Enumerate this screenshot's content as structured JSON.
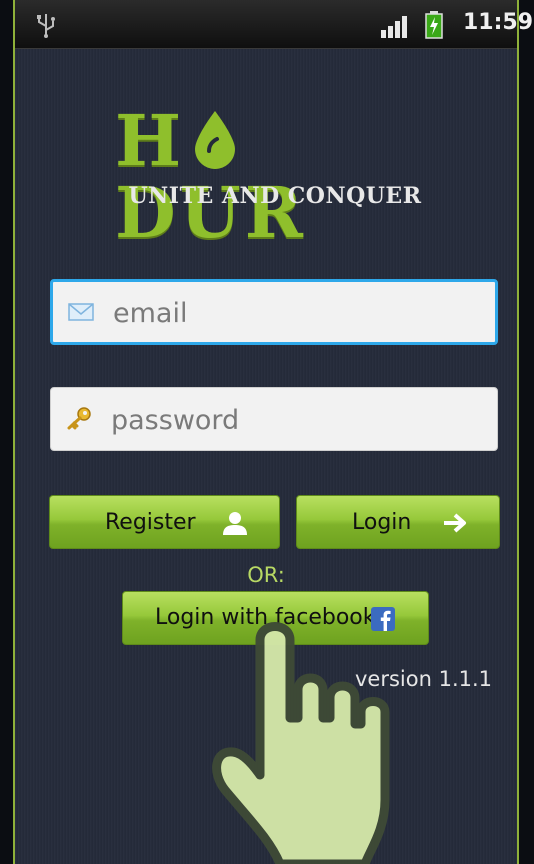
{
  "status_bar": {
    "time": "11:59",
    "icons": [
      "usb-icon",
      "signal-icon",
      "battery-charging-icon"
    ]
  },
  "logo": {
    "part1": "H",
    "part2": "DUR",
    "tagline": "UNITE AND CONQUER"
  },
  "form": {
    "email_placeholder": "email",
    "password_placeholder": "password",
    "email_icon": "envelope-icon",
    "password_icon": "key-icon"
  },
  "buttons": {
    "register_label": "Register",
    "register_icon": "person-icon",
    "login_label": "Login",
    "login_icon": "arrow-right-icon",
    "or_label": "OR:",
    "facebook_label": "Login with facebook",
    "facebook_icon": "facebook-icon"
  },
  "version": "version 1.1.1",
  "colors": {
    "accent_green": "#8fbf2c",
    "focus_blue": "#2ea8ea",
    "background": "#242a3a"
  }
}
